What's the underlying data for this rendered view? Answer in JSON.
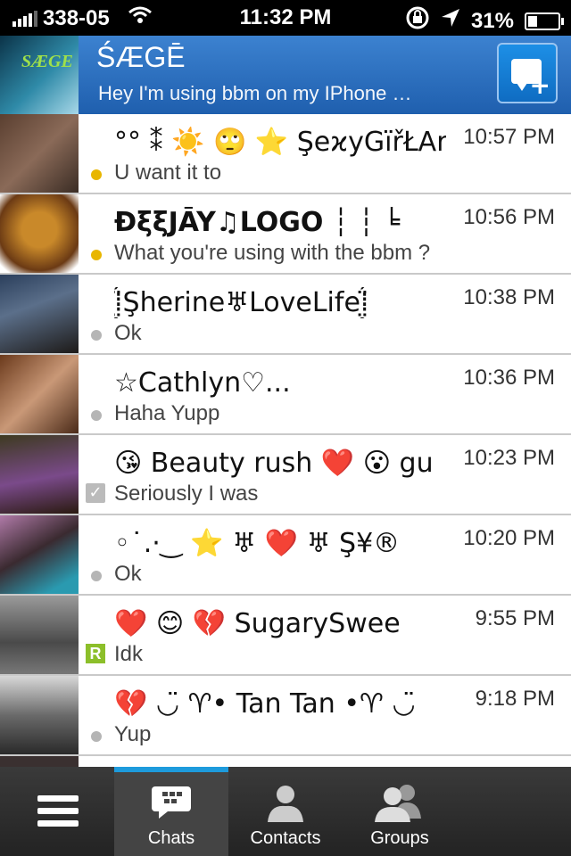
{
  "status_bar": {
    "carrier": "338-05",
    "time": "11:32 PM",
    "battery": "31%",
    "battery_level": 0.31
  },
  "header": {
    "name": "ŚÆGĒ",
    "status": "Hey I'm using bbm on my IPhone …",
    "avatar_text": "SÆGE"
  },
  "chats": [
    {
      "title": "°° ⁑ ☀️ 🙄 ⭐ ŞeϰyGïřŁAr",
      "time": "10:57 PM",
      "message": "U want it to",
      "indicator": "yellow-dot"
    },
    {
      "title": "ĐξξJĀY♫LOGO ┆ ┆ ╘",
      "time": "10:56 PM",
      "message": "What you're using with the bbm ?",
      "indicator": "yellow-dot"
    },
    {
      "title": "⁞̤̥̈́Şherine♅LoveLife⁞̤̥̈́",
      "time": "10:38 PM",
      "message": "Ok",
      "indicator": "grey-dot"
    },
    {
      "title": "☆Cathlyn♡...",
      "time": "10:36 PM",
      "message": "Haha Yupp",
      "indicator": "grey-dot"
    },
    {
      "title": "😘 Beauty rush ❤️ 😮 gu",
      "time": "10:23 PM",
      "message": "Seriously I was",
      "indicator": "check"
    },
    {
      "title": "◦˙.·‿ ⭐ ♅ ❤️ ♅ Ş¥®",
      "time": "10:20 PM",
      "message": "Ok",
      "indicator": "grey-dot"
    },
    {
      "title": "❤️ 😊 💔 SugarySwee",
      "time": "9:55 PM",
      "message": "Idk",
      "indicator": "r-badge"
    },
    {
      "title": "💔 ◡̈ ♈• Tan Tan •♈ ◡̈",
      "time": "9:18 PM",
      "message": "Yup",
      "indicator": "grey-dot"
    }
  ],
  "tabs": {
    "chats": "Chats",
    "contacts": "Contacts",
    "groups": "Groups"
  },
  "colors": {
    "header": "#2a70c0",
    "accent": "#1e9bdc",
    "unread_dot": "#e8b600",
    "read_dot": "#b5b5b5"
  }
}
